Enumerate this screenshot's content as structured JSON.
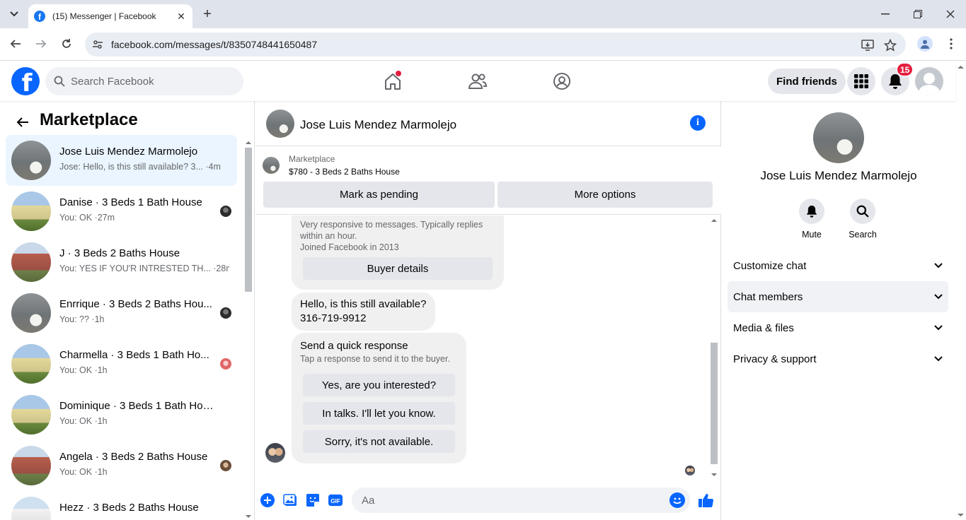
{
  "browser": {
    "tab_title": "(15) Messenger | Facebook",
    "url": "facebook.com/messages/t/8350748441650487"
  },
  "header": {
    "search_placeholder": "Search Facebook",
    "find_friends_label": "Find friends",
    "notification_count": "15",
    "brand_color": "#0866ff"
  },
  "left": {
    "title": "Marketplace",
    "chats": [
      {
        "name": "Jose Luis Mendez Marmolejo",
        "preview": "Jose: Hello, is this still available? 3... ·4m",
        "thumb": "bathroom-photo",
        "active": true
      },
      {
        "name": "Danise · 3 Beds 1 Bath House",
        "preview": "You: OK ·27m",
        "thumb": "yellow-house-photo"
      },
      {
        "name": "J · 3 Beds 2 Baths House",
        "preview": "You: YES IF YOU'R INTRESTED TH... ·28m",
        "thumb": "red-house-photo"
      },
      {
        "name": "Enrrique · 3 Beds 2 Baths Hou...",
        "preview": "You: ?? ·1h",
        "thumb": "bathroom-photo"
      },
      {
        "name": "Charmella · 3 Beds 1 Bath Ho...",
        "preview": "You: OK ·1h",
        "thumb": "yellow-house-photo"
      },
      {
        "name": "Dominique · 3 Beds 1 Bath House",
        "preview": "You: OK ·1h",
        "thumb": "yellow-house-photo"
      },
      {
        "name": "Angela · 3 Beds 2 Baths House",
        "preview": "You: OK ·1h",
        "thumb": "red-house-photo"
      },
      {
        "name": "Hezz · 3 Beds 2 Baths House",
        "preview": "",
        "thumb": "white-house-photo"
      }
    ]
  },
  "conversation": {
    "contact_name": "Jose Luis Mendez Marmolejo",
    "marketplace_label": "Marketplace",
    "listing_title": "$780 - 3 Beds 2 Baths House",
    "mark_pending_label": "Mark as pending",
    "more_options_label": "More options",
    "buyer_info_line1": "Very responsive to messages. Typically replies",
    "buyer_info_line2": "within an hour.",
    "buyer_info_line3": "Joined Facebook in 2013",
    "buyer_details_label": "Buyer details",
    "message_line1": "Hello, is this still available?",
    "message_line2": "316-719-9912",
    "quick_response_title": "Send a quick response",
    "quick_response_hint": "Tap a response to send it to the buyer.",
    "quick_replies": [
      "Yes, are you interested?",
      "In talks. I'll let you know.",
      "Sorry, it's not available."
    ],
    "composer_placeholder": "Aa",
    "gif_label": "GIF"
  },
  "info_panel": {
    "name": "Jose Luis Mendez Marmolejo",
    "mute_label": "Mute",
    "search_label": "Search",
    "sections": [
      "Customize chat",
      "Chat members",
      "Media & files",
      "Privacy & support"
    ]
  }
}
